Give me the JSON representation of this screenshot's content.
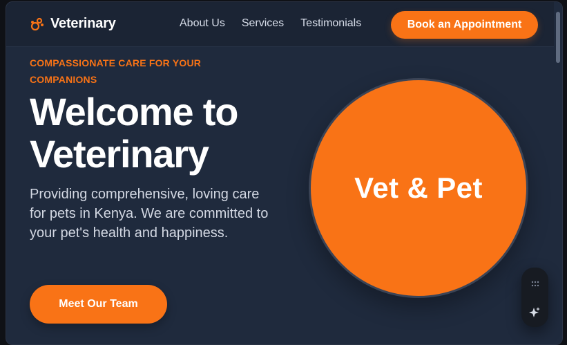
{
  "brand": {
    "name": "Veterinary",
    "accent": "#f97316",
    "logo_icon": "paw-network-icon"
  },
  "nav": {
    "items": [
      "About Us",
      "Services",
      "Testimonials"
    ],
    "cta_label": "Book an Appointment"
  },
  "hero": {
    "eyebrow": "COMPASSIONATE CARE FOR YOUR COMPANIONS",
    "title": "Welcome to Veterinary",
    "description": "Providing comprehensive, loving care for pets in Kenya. We are committed to your pet's health and happiness.",
    "button_label": "Meet Our Team",
    "circle_text": "Vet & Pet"
  },
  "floating_panel": {
    "icons": [
      "grid-dots-icon",
      "sparkle-icon"
    ]
  }
}
